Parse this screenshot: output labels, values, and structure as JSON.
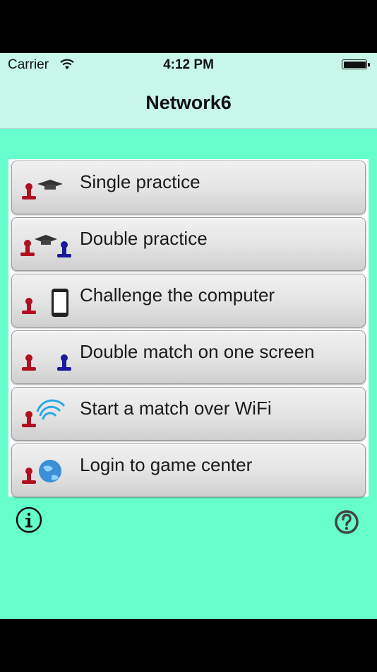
{
  "status_bar": {
    "carrier": "Carrier",
    "time": "4:12 PM"
  },
  "nav": {
    "title": "Network6"
  },
  "menu": {
    "items": [
      {
        "label": "Single practice",
        "icon": "player-with-grad-cap-icon"
      },
      {
        "label": "Double practice",
        "icon": "two-players-with-grad-cap-icon"
      },
      {
        "label": "Challenge the computer",
        "icon": "player-vs-phone-icon"
      },
      {
        "label": "Double match on one screen",
        "icon": "red-vs-blue-player-icon"
      },
      {
        "label": "Start a match over WiFi",
        "icon": "player-wifi-icon"
      },
      {
        "label": "Login to game center",
        "icon": "player-globe-icon"
      }
    ]
  },
  "footer": {
    "info_icon": "info-icon",
    "help_icon": "help-icon"
  },
  "colors": {
    "background": "#66ffcc",
    "header": "#c8f7ea",
    "red_piece": "#b01020",
    "blue_piece": "#1a1a9a"
  }
}
